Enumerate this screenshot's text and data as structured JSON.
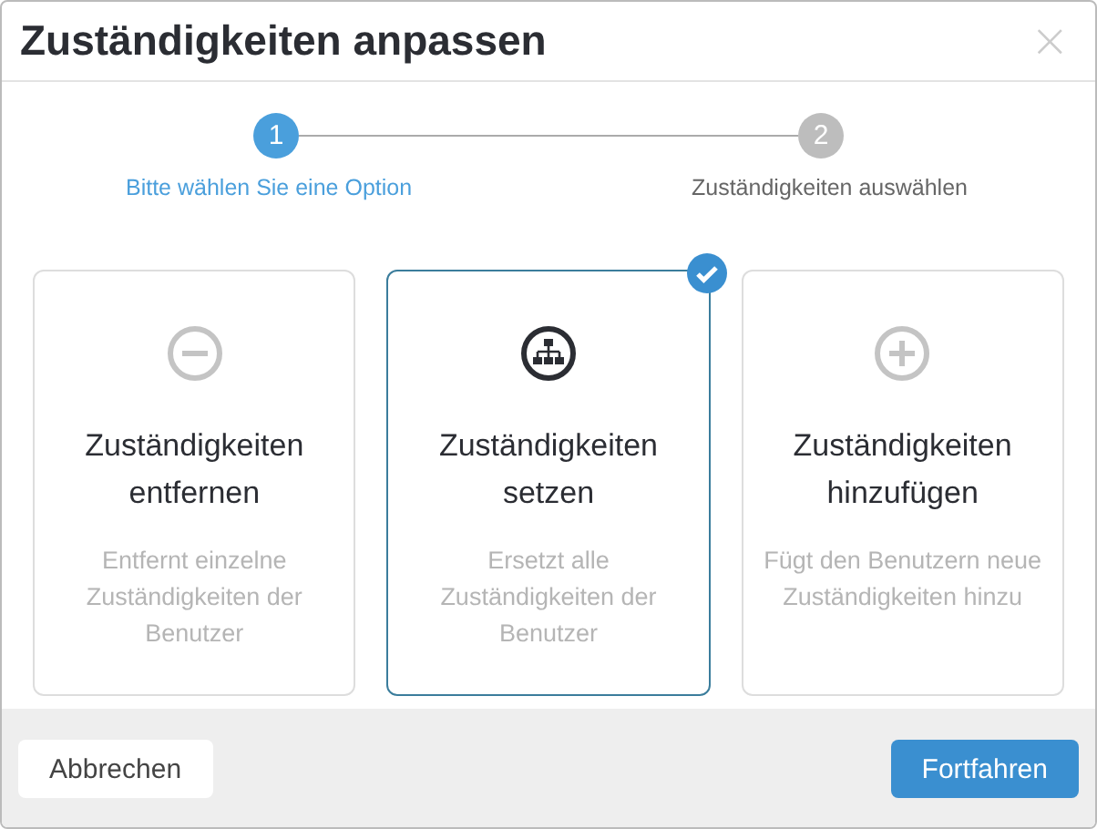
{
  "dialog": {
    "title": "Zuständigkeiten anpassen",
    "close": "×"
  },
  "steps": [
    {
      "number": "1",
      "label": "Bitte wählen Sie eine Option",
      "selected": true
    },
    {
      "number": "2",
      "label": "Zuständigkeiten auswählen",
      "selected": false
    }
  ],
  "options": [
    {
      "kind": "remove",
      "title": "Zuständigkeiten entfernen",
      "description": "Entfernt einzelne Zuständigkeiten der Benutzer",
      "selected": false
    },
    {
      "kind": "set",
      "title": "Zuständigkeiten setzen",
      "description": "Ersetzt alle Zuständigkeiten der Benutzer",
      "selected": true
    },
    {
      "kind": "add",
      "title": "Zuständigkeiten hinzufügen",
      "description": "Fügt den Benutzern neue Zuständigkeiten hinzu",
      "selected": false
    }
  ],
  "buttons": {
    "cancel": "Abbrechen",
    "continue": "Fortfahren"
  }
}
